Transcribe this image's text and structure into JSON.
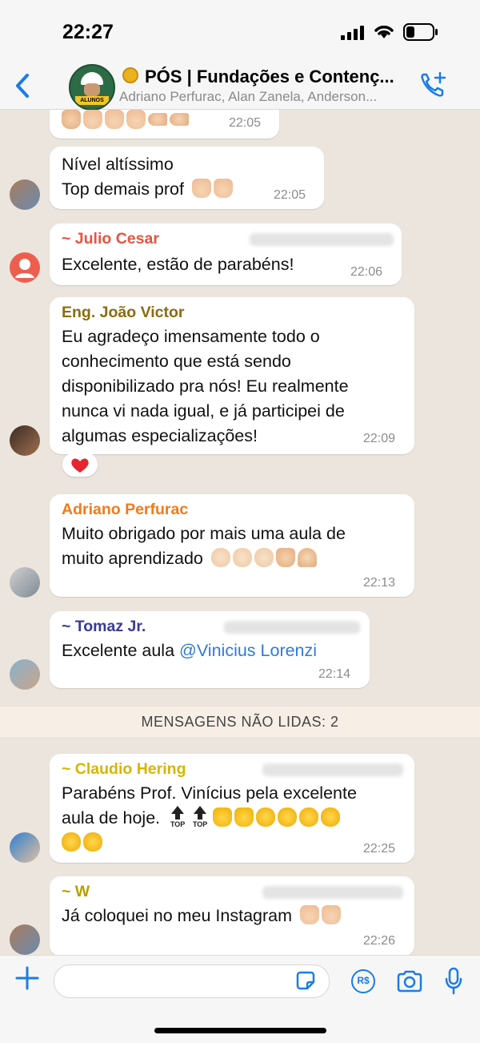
{
  "status_bar": {
    "time": "22:27"
  },
  "header": {
    "avatar_label": "ALUNOS",
    "title": "PÓS | Fundações e Contenç...",
    "subtitle": "Adriano Perfurac, Alan Zanela, Anderson..."
  },
  "messages": [
    {
      "sender": "",
      "text": "",
      "time": "22:05"
    },
    {
      "sender": "",
      "lines": [
        "Nível altíssimo",
        "Top demais prof"
      ],
      "time": "22:05"
    },
    {
      "sender": "~ Julio Cesar",
      "sender_color": "#e8533f",
      "lines": [
        "Excelente, estão de parabéns!"
      ],
      "time": "22:06"
    },
    {
      "sender": "Eng. João Victor",
      "sender_color": "#8a6d12",
      "lines": [
        "Eu agradeço imensamente todo o",
        "conhecimento que está sendo",
        "disponibilizado pra nós! Eu realmente",
        "nunca vi nada igual, e já participei de",
        "algumas especializações!"
      ],
      "time": "22:09",
      "reaction": "heart"
    },
    {
      "sender": "Adriano Perfurac",
      "sender_color": "#f07b1c",
      "lines": [
        "Muito obrigado por mais uma aula de",
        "muito aprendizado"
      ],
      "time": "22:13"
    },
    {
      "sender": "~ Tomaz Jr.",
      "sender_color": "#3a3a9a",
      "lines": [
        "Excelente aula"
      ],
      "mention": "@Vinicius Lorenzi",
      "time": "22:14"
    },
    {
      "sender": "~ Claudio Hering",
      "sender_color": "#d6b600",
      "lines": [
        "Parabéns Prof. Vinícius pela excelente",
        "aula de hoje."
      ],
      "top_badge": "TOP",
      "time": "22:25"
    },
    {
      "sender": "~ W",
      "sender_color": "#b8a000",
      "lines": [
        "Já coloquei no meu Instagram"
      ],
      "time": "22:26"
    }
  ],
  "unread_divider": "MENSAGENS NÃO LIDAS: 2",
  "composer": {
    "placeholder": "",
    "rs_label": "R$"
  },
  "colors": {
    "accent": "#1a7ce8",
    "chat_bg": "#ece5dd",
    "bubble": "#ffffff"
  }
}
